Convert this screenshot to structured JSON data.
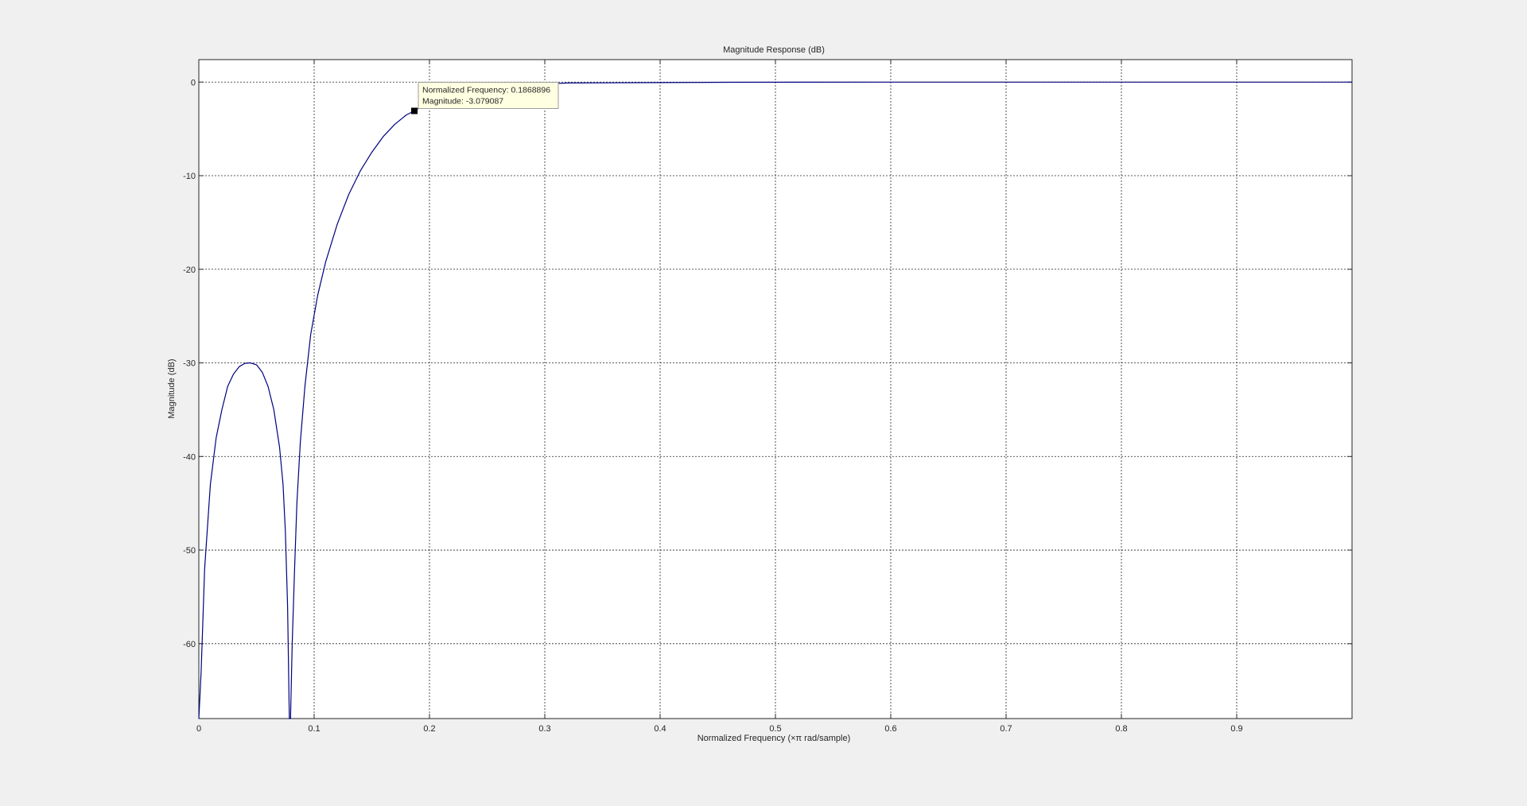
{
  "chart_data": {
    "type": "line",
    "title": "Magnitude Response (dB)",
    "xlabel": "Normalized Frequency (×π rad/sample)",
    "ylabel": "Magnitude (dB)",
    "xlim": [
      0,
      1
    ],
    "ylim": [
      -68,
      2.4
    ],
    "grid": true,
    "x_ticks": [
      0,
      0.1,
      0.2,
      0.3,
      0.4,
      0.5,
      0.6,
      0.7,
      0.8,
      0.9
    ],
    "x_tick_labels": [
      "0",
      "0.1",
      "0.2",
      "0.3",
      "0.4",
      "0.5",
      "0.6",
      "0.7",
      "0.8",
      "0.9"
    ],
    "y_ticks": [
      0,
      -10,
      -20,
      -30,
      -40,
      -50,
      -60
    ],
    "y_tick_labels": [
      "0",
      "-10",
      "-20",
      "-30",
      "-40",
      "-50",
      "-60"
    ],
    "line_color": "#00007f",
    "series": [
      {
        "x": [
          0,
          0.002,
          0.005,
          0.01,
          0.015,
          0.02,
          0.025,
          0.03,
          0.035,
          0.04,
          0.0445,
          0.05,
          0.055,
          0.06,
          0.065,
          0.07,
          0.073,
          0.075,
          0.077,
          0.0785,
          0.0795,
          0.081,
          0.083,
          0.085,
          0.088,
          0.092,
          0.097,
          0.103,
          0.11,
          0.12,
          0.13,
          0.14,
          0.15,
          0.16,
          0.17,
          0.18,
          0.1869,
          0.2,
          0.22,
          0.25,
          0.28,
          0.32,
          0.4,
          0.46,
          0.6,
          0.8,
          1.0
        ],
        "y": [
          -68,
          -63,
          -52,
          -43,
          -38,
          -35,
          -32.5,
          -31.2,
          -30.4,
          -30.05,
          -30,
          -30.2,
          -31,
          -32.5,
          -35,
          -39,
          -43,
          -48,
          -56,
          -68,
          -68,
          -60,
          -52,
          -45,
          -38.5,
          -32.5,
          -27,
          -22.8,
          -19.2,
          -15.2,
          -12,
          -9.5,
          -7.5,
          -5.8,
          -4.5,
          -3.5,
          -3.079,
          -2.1,
          -1.2,
          -0.6,
          -0.3,
          -0.1,
          -0.05,
          -0.02,
          0,
          0,
          0
        ]
      }
    ],
    "datatip": {
      "x": 0.1868896,
      "y": -3.079087,
      "line1": "Normalized Frequency: 0.1868896",
      "line2": "Magnitude: -3.079087"
    }
  }
}
